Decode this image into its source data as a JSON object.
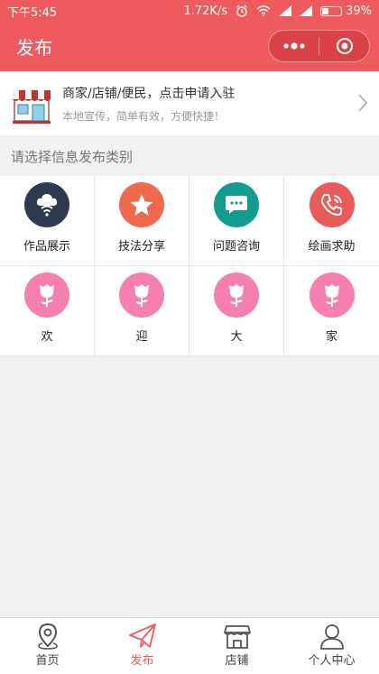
{
  "status_bar": {
    "time": "下午5:45",
    "speed": "1.72K/s",
    "battery": "39%",
    "battery_level": 0.39
  },
  "nav": {
    "title": "发布"
  },
  "merchant": {
    "title": "商家/店铺/便民，点击申请入驻",
    "subtitle": "本地宣传，简单有效，方便快捷！"
  },
  "section": {
    "title": "请选择信息发布类别"
  },
  "categories": [
    {
      "label": "作品展示",
      "icon": "cloud-signal-icon",
      "color": "#2f3b4c"
    },
    {
      "label": "技法分享",
      "icon": "star-icon",
      "color": "#ee6a4f"
    },
    {
      "label": "问题咨询",
      "icon": "chat-bubble-icon",
      "color": "#149b8d"
    },
    {
      "label": "绘画求助",
      "icon": "phone-icon",
      "color": "#e85b5b"
    },
    {
      "label": "欢",
      "icon": "flower-icon",
      "color": "#f57fae"
    },
    {
      "label": "迎",
      "icon": "flower-icon",
      "color": "#f57fae"
    },
    {
      "label": "大",
      "icon": "flower-icon",
      "color": "#f57fae"
    },
    {
      "label": "家",
      "icon": "flower-icon",
      "color": "#f57fae"
    }
  ],
  "tabs": [
    {
      "label": "首页",
      "icon": "location-pin-icon",
      "active": false
    },
    {
      "label": "发布",
      "icon": "paper-plane-icon",
      "active": true
    },
    {
      "label": "店铺",
      "icon": "store-icon",
      "active": false
    },
    {
      "label": "个人中心",
      "icon": "person-icon",
      "active": false
    }
  ],
  "colors": {
    "brand": "#ef5a5f",
    "background": "#f1f1f1"
  }
}
